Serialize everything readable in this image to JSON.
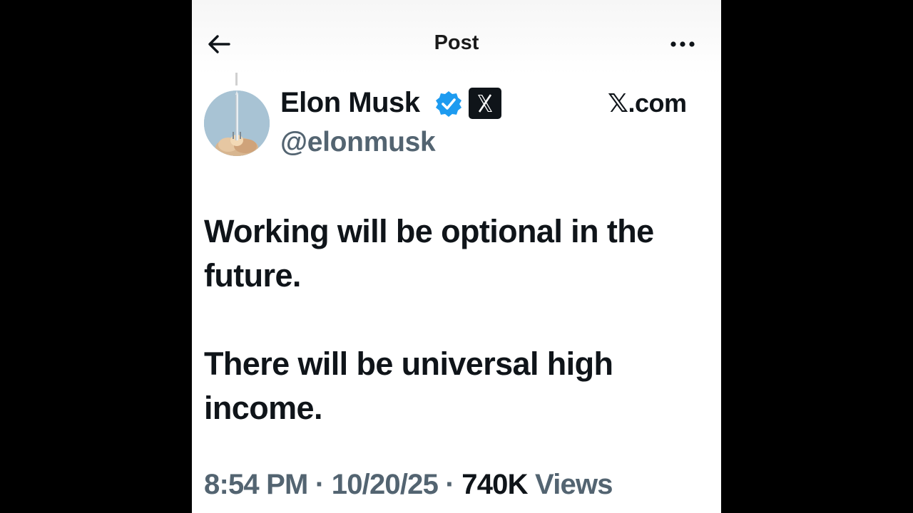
{
  "header": {
    "title": "Post",
    "back_icon": "arrow-left-icon",
    "more_icon": "more-horizontal-icon"
  },
  "author": {
    "display_name": "Elon Musk",
    "handle": "@elonmusk",
    "verified": true,
    "verified_badge_color": "#1d9bf0",
    "affiliate_badge": "x-logo-icon",
    "avatar": "rocket-launch-avatar"
  },
  "watermark": {
    "text": "𝕏.com"
  },
  "post": {
    "paragraphs": [
      "Working will be optional in the future.",
      "There will be universal high income."
    ]
  },
  "meta": {
    "time": "8:54 PM",
    "separator": "·",
    "date": "10/20/25",
    "views_count": "740K",
    "views_label": "Views"
  },
  "colors": {
    "text_primary": "#0f1419",
    "text_secondary": "#536471",
    "background": "#ffffff",
    "letterbox": "#000000"
  }
}
